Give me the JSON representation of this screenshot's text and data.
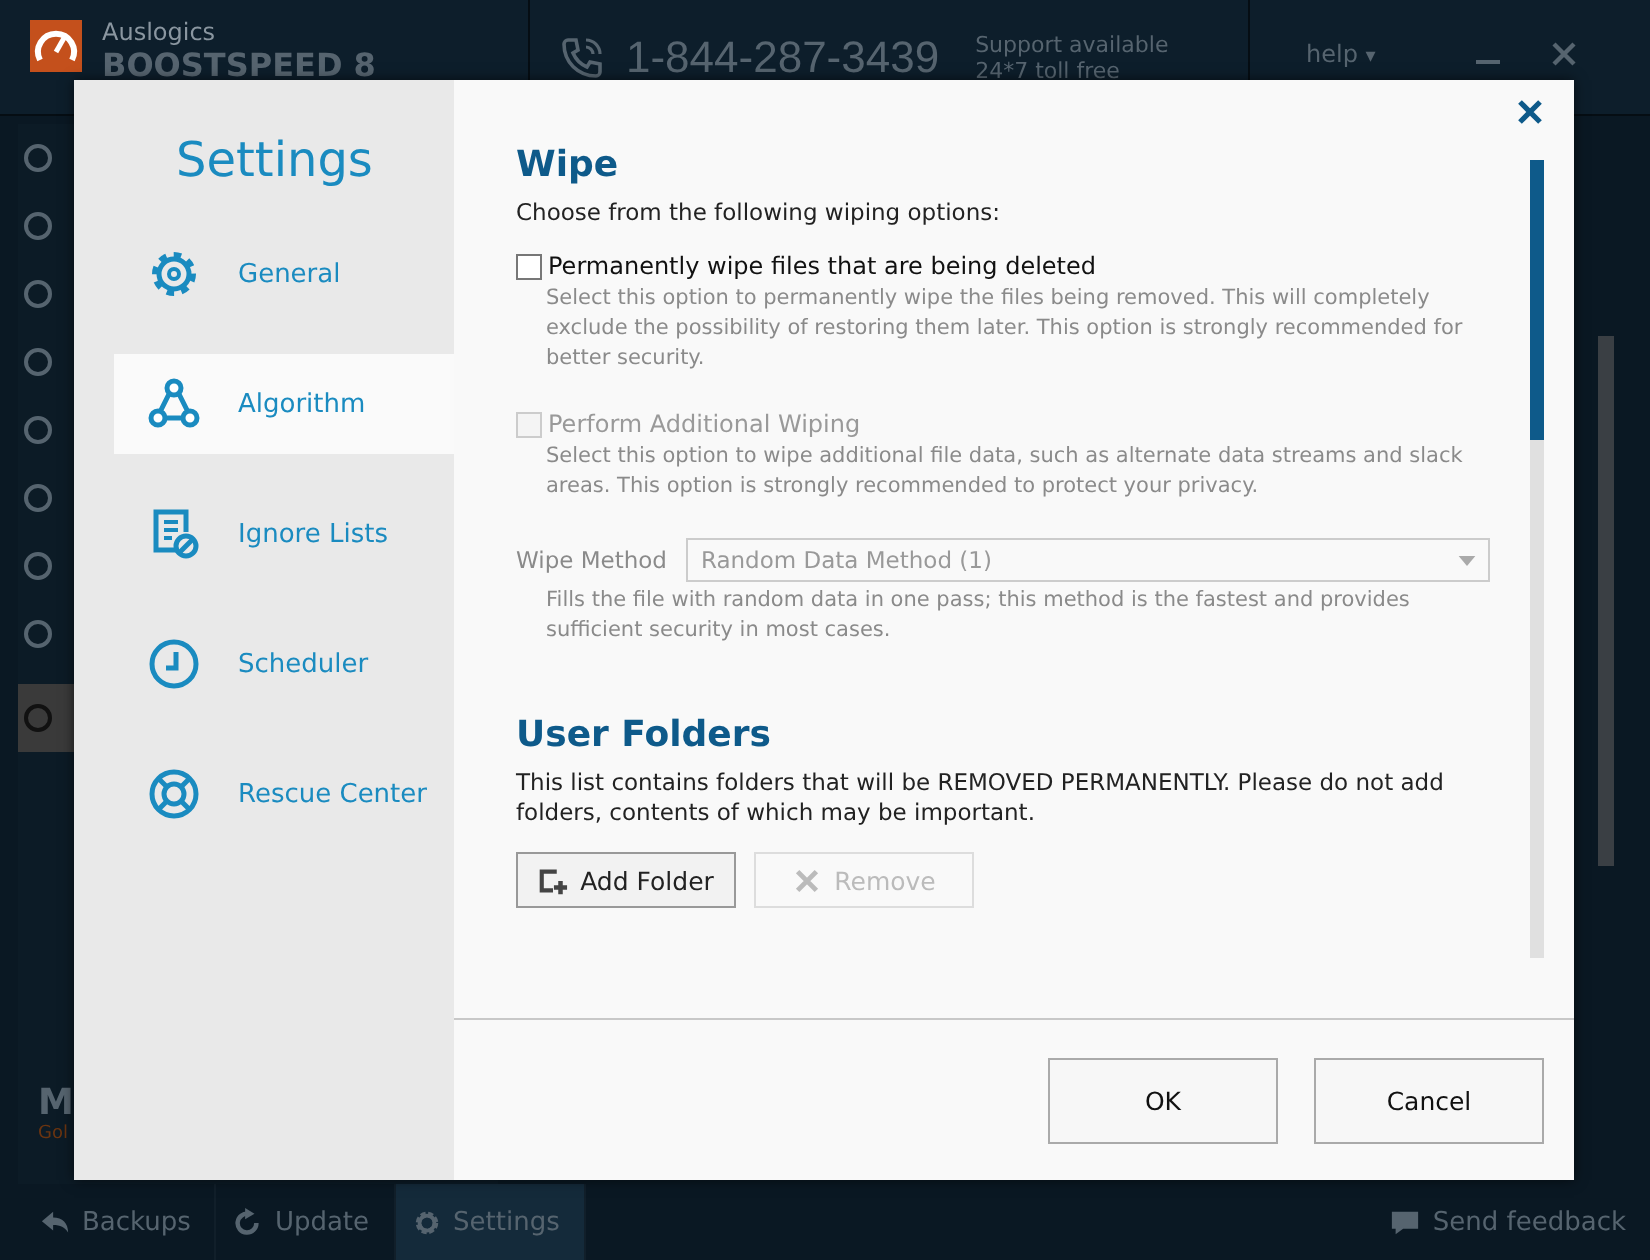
{
  "app": {
    "brand_top": "Auslogics",
    "brand_name": "BOOSTSPEED 8",
    "phone": "1-844-287-3439",
    "support_line1": "Support available",
    "support_line2": "24*7 toll free",
    "help": "help",
    "help_caret": "▾",
    "sidebar_icons": [
      {
        "selected": false
      },
      {
        "selected": false
      },
      {
        "selected": false
      },
      {
        "selected": false
      },
      {
        "selected": false
      },
      {
        "selected": false
      },
      {
        "selected": false
      },
      {
        "selected": false
      },
      {
        "selected": true
      }
    ],
    "promo_title": "M",
    "promo_sub": "Gol"
  },
  "dialog": {
    "title": "Settings",
    "nav": [
      {
        "label": "General",
        "selected": false
      },
      {
        "label": "Algorithm",
        "selected": true
      },
      {
        "label": "Ignore Lists",
        "selected": false
      },
      {
        "label": "Scheduler",
        "selected": false
      },
      {
        "label": "Rescue Center",
        "selected": false
      }
    ],
    "wipe": {
      "heading": "Wipe",
      "intro": "Choose from the following wiping options:",
      "options": [
        {
          "label": "Permanently wipe files that are being deleted",
          "checked": false,
          "disabled": false,
          "description": "Select this option to permanently wipe the files being removed. This will completely exclude the possibility of restoring them later. This option is strongly recommended for better security."
        },
        {
          "label": "Perform Additional Wiping",
          "checked": false,
          "disabled": true,
          "description": "Select this option to wipe additional file data, such as alternate data streams and slack areas. This option is strongly recommended to protect your privacy."
        }
      ],
      "method_label": "Wipe Method",
      "method_value": "Random Data Method (1)",
      "method_disabled": true,
      "method_description": "Fills the file with random data in one pass; this method is the fastest and provides sufficient security in most cases."
    },
    "folders": {
      "heading": "User Folders",
      "text": "This list contains folders that will be REMOVED PERMANENTLY. Please do not add folders, contents of which may be important.",
      "buttons": [
        {
          "label": "Add Folder",
          "disabled": false
        },
        {
          "label": "Remove",
          "disabled": true
        }
      ]
    },
    "buttons": [
      "OK",
      "Cancel"
    ]
  },
  "footer": {
    "items": [
      {
        "label": "Backups",
        "selected": false
      },
      {
        "label": "Update",
        "selected": false
      },
      {
        "label": "Settings",
        "selected": true
      }
    ],
    "feedback": "Send feedback"
  }
}
